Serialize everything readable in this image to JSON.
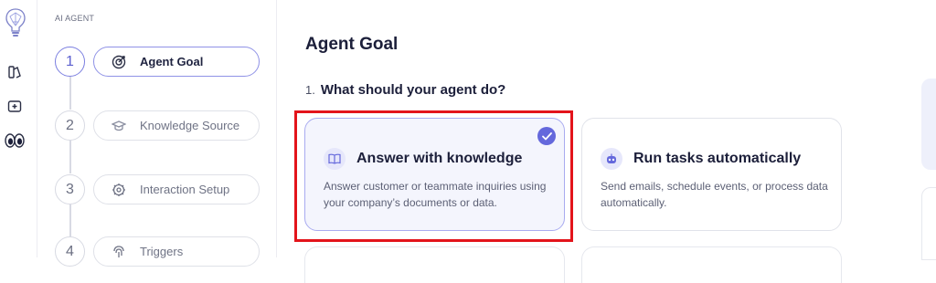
{
  "rail": {
    "icons": [
      "brain-logo-icon",
      "books-icon",
      "add-folder-icon",
      "eyes-icon"
    ]
  },
  "sidebar": {
    "section_label": "AI AGENT",
    "steps": [
      {
        "number": "1",
        "label": "Agent Goal",
        "icon": "target-icon",
        "active": true
      },
      {
        "number": "2",
        "label": "Knowledge Source",
        "icon": "graduation-cap-icon",
        "active": false
      },
      {
        "number": "3",
        "label": "Interaction Setup",
        "icon": "gear-icon",
        "active": false
      },
      {
        "number": "4",
        "label": "Triggers",
        "icon": "fingerprint-icon",
        "active": false
      }
    ]
  },
  "main": {
    "title": "Agent Goal",
    "question_number": "1.",
    "question": "What should your agent do?",
    "options": [
      {
        "title": "Answer with knowledge",
        "description": "Answer customer or teammate inquiries using your company’s documents or data.",
        "icon": "book-open-icon",
        "selected": true
      },
      {
        "title": "Run tasks automatically",
        "description": "Send emails, schedule events, or process data automatically.",
        "icon": "robot-icon",
        "selected": false
      }
    ]
  },
  "colors": {
    "accent": "#6468dc",
    "highlight": "#e3141b"
  }
}
